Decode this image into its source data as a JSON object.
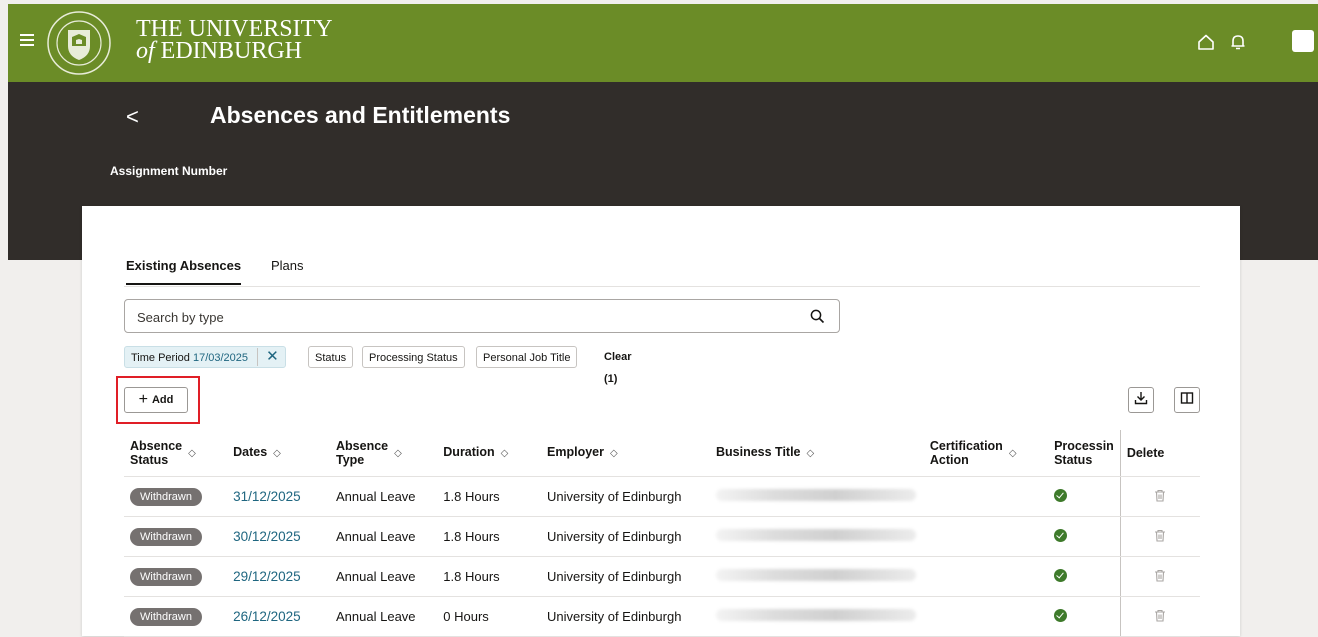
{
  "header": {
    "university_line1": "THE UNIVERSITY",
    "university_line2_of": "of",
    "university_line2": "EDINBURGH"
  },
  "page": {
    "back_label": "<",
    "title": "Absences and Entitlements",
    "assignment_label": "Assignment Number"
  },
  "tabs": [
    {
      "label": "Existing Absences",
      "active": true
    },
    {
      "label": "Plans",
      "active": false
    }
  ],
  "search": {
    "placeholder": "Search by type",
    "value": ""
  },
  "filters": {
    "time_period_label": "Time Period",
    "time_period_value": "17/03/2025",
    "chips": [
      "Status",
      "Processing Status",
      "Personal Job Title"
    ],
    "clear_label": "Clear (1)"
  },
  "toolbar": {
    "add_label": "Add"
  },
  "table": {
    "headers": {
      "absence_status_1": "Absence",
      "absence_status_2": "Status",
      "dates": "Dates",
      "absence_type_1": "Absence",
      "absence_type_2": "Type",
      "duration": "Duration",
      "employer": "Employer",
      "business_title": "Business Title",
      "certification_1": "Certification",
      "certification_2": "Action",
      "processing_1": "Processin",
      "processing_2": "Status",
      "delete": "Delete"
    },
    "rows": [
      {
        "status": "Withdrawn",
        "date": "31/12/2025",
        "type": "Annual Leave",
        "duration": "1.8 Hours",
        "employer": "University of Edinburgh"
      },
      {
        "status": "Withdrawn",
        "date": "30/12/2025",
        "type": "Annual Leave",
        "duration": "1.8 Hours",
        "employer": "University of Edinburgh"
      },
      {
        "status": "Withdrawn",
        "date": "29/12/2025",
        "type": "Annual Leave",
        "duration": "1.8 Hours",
        "employer": "University of Edinburgh"
      },
      {
        "status": "Withdrawn",
        "date": "26/12/2025",
        "type": "Annual Leave",
        "duration": "0 Hours",
        "employer": "University of Edinburgh"
      }
    ]
  },
  "colors": {
    "brand_green": "#6b8c27",
    "dark_band": "#312d2a",
    "link": "#1f6680",
    "highlight": "#e01e26"
  },
  "icons": [
    "menu-icon",
    "university-crest-icon",
    "home-icon",
    "bell-icon",
    "search-icon",
    "close-icon",
    "plus-icon",
    "download-icon",
    "columns-icon",
    "sort-icon",
    "check-circle-icon",
    "trash-icon"
  ]
}
